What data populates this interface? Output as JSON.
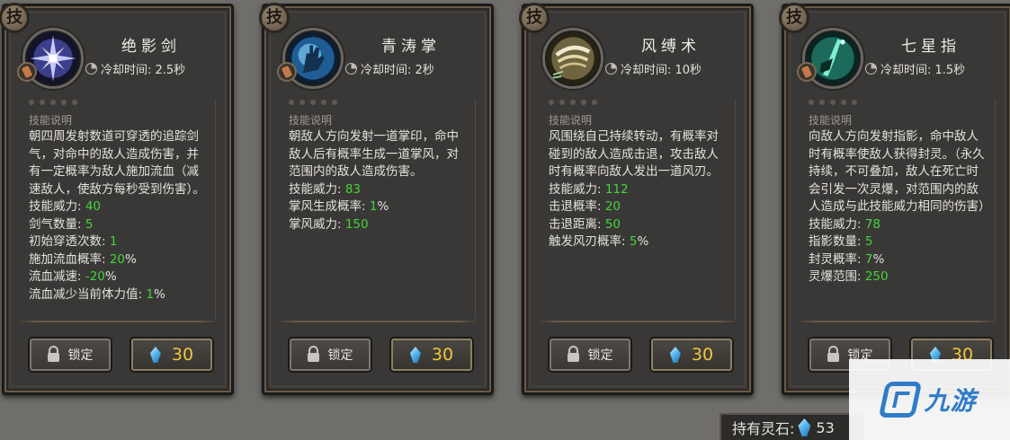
{
  "colors": {
    "stat_value": "#43d43c",
    "price": "#f2c63c",
    "card_bg": "#3a3836"
  },
  "cards": [
    {
      "badge": "技",
      "name": "绝影剑",
      "icon": "purple-star-sigil-icon",
      "cooldown": "冷却时间: 2.5秒",
      "desc_header": "技能说明",
      "desc": "朝四周发射数道可穿透的追踪剑气，对命中的敌人造成伤害，并有一定概率为敌人施加流血（减速敌人，使敌方每秒受到伤害）。",
      "stats": [
        {
          "label": "技能威力: ",
          "value": "40",
          "suffix": ""
        },
        {
          "label": "剑气数量: ",
          "value": "5",
          "suffix": ""
        },
        {
          "label": "初始穿透次数: ",
          "value": "1",
          "suffix": ""
        },
        {
          "label": "施加流血概率: ",
          "value": "20",
          "suffix": "%"
        },
        {
          "label": "流血减速: ",
          "value": "-20",
          "suffix": "%"
        },
        {
          "label": "流血减少当前体力值: ",
          "value": "1",
          "suffix": "%"
        }
      ],
      "lock_label": "锁定",
      "price": "30"
    },
    {
      "badge": "技",
      "name": "青涛掌",
      "icon": "blue-palm-icon",
      "cooldown": "冷却时间: 2秒",
      "desc_header": "技能说明",
      "desc": "朝敌人方向发射一道掌印，命中敌人后有概率生成一道掌风，对范围内的敌人造成伤害。",
      "stats": [
        {
          "label": "技能威力: ",
          "value": "83",
          "suffix": ""
        },
        {
          "label": "掌风生成概率: ",
          "value": "1",
          "suffix": "%"
        },
        {
          "label": "掌风威力: ",
          "value": "150",
          "suffix": ""
        }
      ],
      "lock_label": "锁定",
      "price": "30"
    },
    {
      "badge": "技",
      "name": "风缚术",
      "icon": "wind-swirl-icon",
      "cooldown": "冷却时间: 10秒",
      "desc_header": "技能说明",
      "desc": "风围绕自己持续转动，有概率对碰到的敌人造成击退，攻击敌人时有概率向敌人发出一道风刃。",
      "stats": [
        {
          "label": "技能威力: ",
          "value": "112",
          "suffix": ""
        },
        {
          "label": "击退概率: ",
          "value": "20",
          "suffix": ""
        },
        {
          "label": "击退距离: ",
          "value": "50",
          "suffix": ""
        },
        {
          "label": "触发风刃概率: ",
          "value": "5",
          "suffix": "%"
        }
      ],
      "lock_label": "锁定",
      "price": "30"
    },
    {
      "badge": "技",
      "name": "七星指",
      "icon": "green-finger-icon",
      "cooldown": "冷却时间: 1.5秒",
      "desc_header": "技能说明",
      "desc": "向敌人方向发射指影，命中敌人时有概率使敌人获得封灵。（永久持续，不可叠加，敌人在死亡时会引发一次灵爆，对范围内的敌人造成与此技能威力相同的伤害）",
      "stats": [
        {
          "label": "技能威力: ",
          "value": "78",
          "suffix": ""
        },
        {
          "label": "指影数量: ",
          "value": "5",
          "suffix": ""
        },
        {
          "label": "封灵概率: ",
          "value": "7",
          "suffix": "%"
        },
        {
          "label": "灵爆范围: ",
          "value": "250",
          "suffix": ""
        }
      ],
      "lock_label": "锁定",
      "price": "30"
    }
  ],
  "footer": {
    "label": "持有灵石: ",
    "amount": "53"
  },
  "watermark": {
    "text": "九游"
  }
}
